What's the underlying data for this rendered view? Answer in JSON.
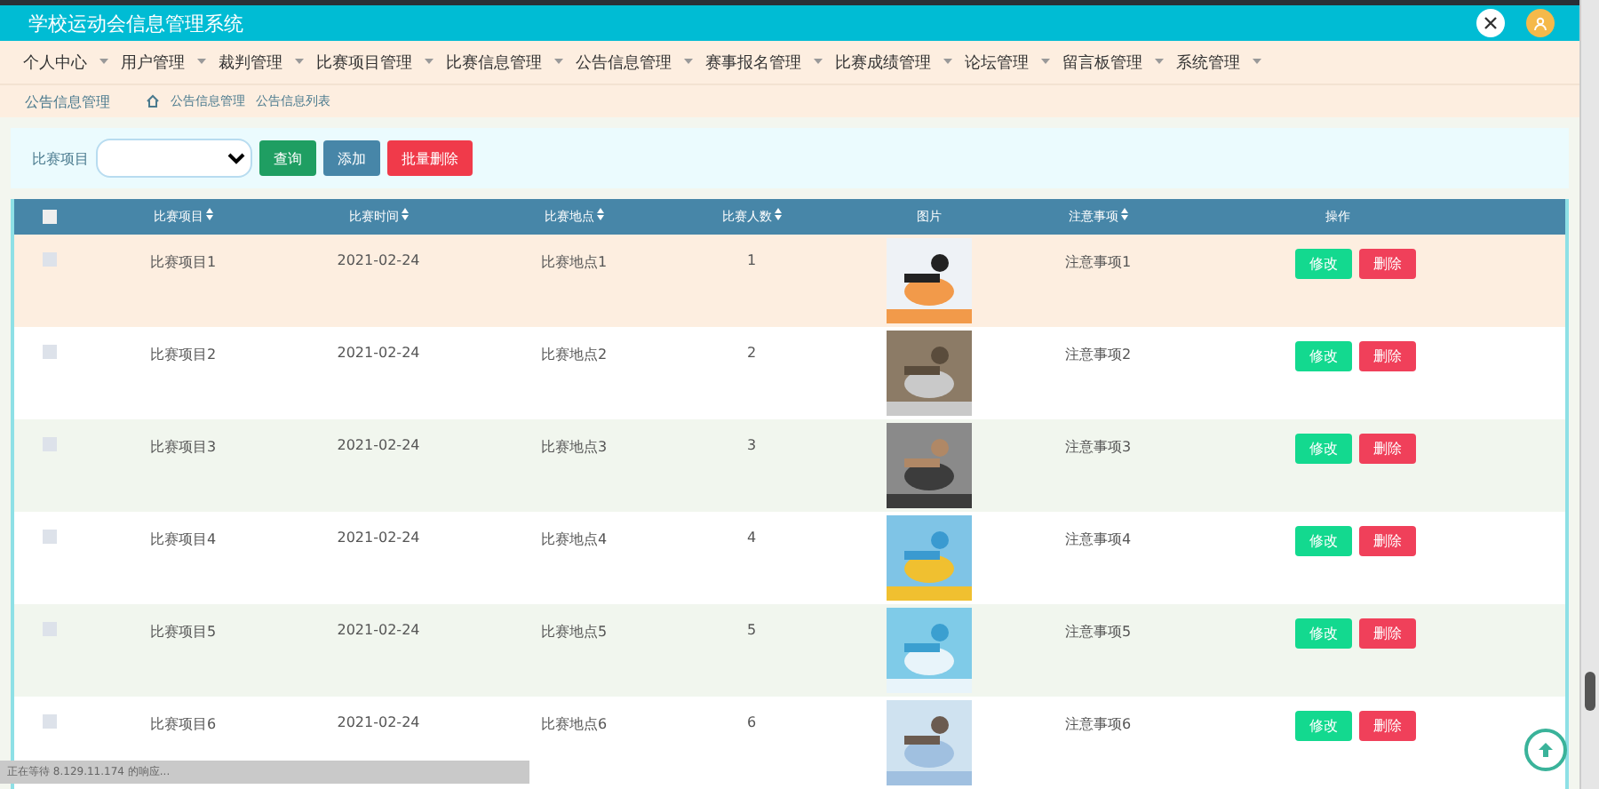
{
  "header": {
    "title": "学校运动会信息管理系统"
  },
  "nav": [
    "个人中心",
    "用户管理",
    "裁判管理",
    "比赛项目管理",
    "比赛信息管理",
    "公告信息管理",
    "赛事报名管理",
    "比赛成绩管理",
    "论坛管理",
    "留言板管理",
    "系统管理"
  ],
  "breadcrumb": {
    "page_title": "公告信息管理",
    "path": "公告信息管理",
    "current": "公告信息列表"
  },
  "filter": {
    "label": "比赛项目",
    "search_button": "查询",
    "add_button": "添加",
    "batch_delete_button": "批量删除"
  },
  "table": {
    "select_all_checked": false,
    "columns": [
      "比赛项目",
      "比赛时间",
      "比赛地点",
      "比赛人数",
      "图片",
      "注意事项",
      "操作"
    ],
    "rows": [
      {
        "checked": false,
        "hovered": true,
        "cells": [
          "比赛项目1",
          "2021-02-24",
          "比赛地点1",
          "1"
        ],
        "note": "注意事项1",
        "edit": "修改",
        "delete": "删除"
      },
      {
        "checked": false,
        "hovered": false,
        "cells": [
          "比赛项目2",
          "2021-02-24",
          "比赛地点2",
          "2"
        ],
        "note": "注意事项2",
        "edit": "修改",
        "delete": "删除"
      },
      {
        "checked": false,
        "hovered": false,
        "cells": [
          "比赛项目3",
          "2021-02-24",
          "比赛地点3",
          "3"
        ],
        "note": "注意事项3",
        "edit": "修改",
        "delete": "删除"
      },
      {
        "checked": false,
        "hovered": false,
        "cells": [
          "比赛项目4",
          "2021-02-24",
          "比赛地点4",
          "4"
        ],
        "note": "注意事项4",
        "edit": "修改",
        "delete": "删除"
      },
      {
        "checked": false,
        "hovered": false,
        "cells": [
          "比赛项目5",
          "2021-02-24",
          "比赛地点5",
          "5"
        ],
        "note": "注意事项5",
        "edit": "修改",
        "delete": "删除"
      },
      {
        "checked": false,
        "hovered": false,
        "cells": [
          "比赛项目6",
          "2021-02-24",
          "比赛地点6",
          "6"
        ],
        "note": "注意事项6",
        "edit": "修改",
        "delete": "删除"
      }
    ]
  },
  "status_bar": "正在等待 8.129.11.174 的响应..."
}
